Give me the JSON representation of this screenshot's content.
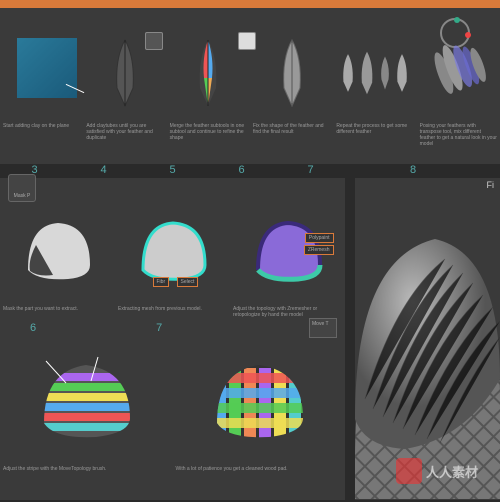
{
  "topbar": {
    "color": "#d97a3a"
  },
  "feathers": {
    "steps": [
      {
        "caption": "Start adding clay on the plane"
      },
      {
        "caption": "Add claytubes until you are satisfied with your feather and duplicate"
      },
      {
        "caption": "Merge the feather subtools in one subtool and continue to refine the shape"
      },
      {
        "caption": "Fix the shape of the feather and find the final result"
      },
      {
        "caption": "Repeat the process to get some different feather"
      },
      {
        "caption": "Posing your feathers with transpose tool, mix different feather to get a natural look in your model"
      }
    ]
  },
  "numbers_a": [
    "3",
    "4",
    "5",
    "6",
    "7"
  ],
  "number_right": "8",
  "numbers_b": [
    "6",
    "7"
  ],
  "mid": {
    "masks_label": "Mask P",
    "move_label": "Move T",
    "captions": [
      "Mask the part you want to extract.",
      "Extracting mesh from previous model.",
      "Adjust the topology with Zremesher or retopologize by hand the model"
    ],
    "tags": [
      "Fibr",
      "Select",
      "Polypaint",
      "ZRemesh"
    ],
    "weave_captions": [
      "Adjust the stripe with the MoveTopology brush.",
      "With a lot of patience you get a cleaned wood pad."
    ]
  },
  "right": {
    "final_label": "Fi"
  },
  "watermark": {
    "text": "人人素材"
  }
}
